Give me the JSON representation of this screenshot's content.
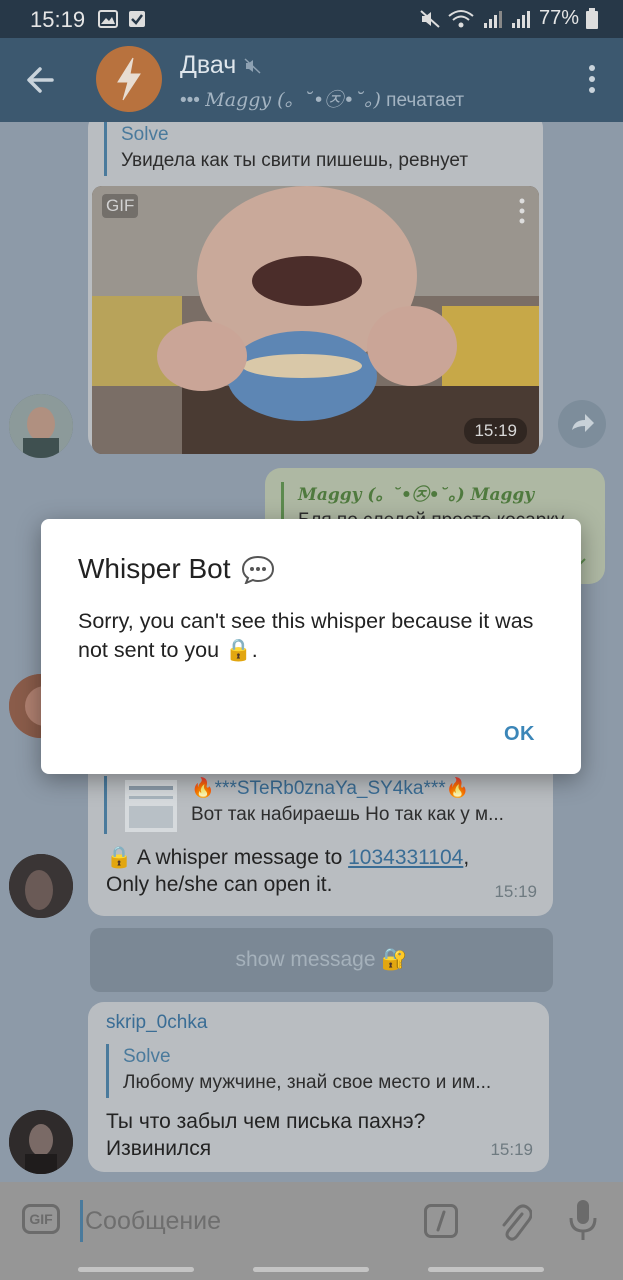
{
  "status_bar": {
    "time": "15:19",
    "battery": "77%"
  },
  "header": {
    "title": "Двач",
    "typing_user": "Maggy (。˘•㉨•˘。)",
    "typing_action": "печатает",
    "typing_dots": "•••"
  },
  "messages": {
    "gif_msg": {
      "reply_name": "Solve",
      "reply_text": "Увидела как ты свити пишешь, ревнует",
      "gif_badge": "GIF",
      "time": "15:19"
    },
    "outgoing": {
      "reply_name": "Maggy (。˘•㉨•˘。) Maggy",
      "reply_text": "Бля по следой просто косарку"
    },
    "whisper_msg": {
      "reply_name": "🔥***STeRb0znaYa_SY4ka***🔥",
      "reply_text": "Вот так набираешь Но так как у м...",
      "text_prefix": "🔒 A whisper message to ",
      "link": "1034331104",
      "text_suffix": ",",
      "text_line2": "Only he/she can open it.",
      "time": "15:19"
    },
    "show_message_button": "show message 🔐",
    "last_msg": {
      "sender": "skrip_0chka",
      "reply_name": "Solve",
      "reply_text": "Любому мужчине, знай свое место и им...",
      "text_line1": "Ты что забыл чем писька пахнэ?",
      "text_line2": "Извинился",
      "time": "15:19"
    }
  },
  "input": {
    "placeholder": "Сообщение",
    "gif_label": "GIF"
  },
  "dialog": {
    "title": "Whisper Bot",
    "body": "Sorry, you can't see this whisper because it was not sent to you 🔒.",
    "ok_label": "OK"
  },
  "colors": {
    "accent": "#3b86b8",
    "header_bg": "#3c586f",
    "link": "#3a6d95"
  }
}
